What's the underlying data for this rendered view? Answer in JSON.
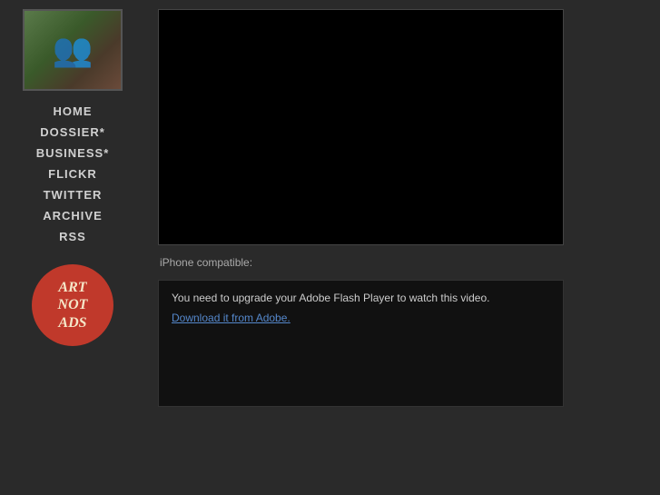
{
  "sidebar": {
    "nav_items": [
      {
        "label": "HOME",
        "id": "home"
      },
      {
        "label": "DOSSIER*",
        "id": "dossier"
      },
      {
        "label": "BUSINESS*",
        "id": "business"
      },
      {
        "label": "FLICKR",
        "id": "flickr"
      },
      {
        "label": "TWITTER",
        "id": "twitter"
      },
      {
        "label": "ARCHIVE",
        "id": "archive"
      },
      {
        "label": "RSS",
        "id": "rss"
      }
    ],
    "art_not_ads_line1": "ART",
    "art_not_ads_line2": "NOT",
    "art_not_ads_line3": "ADS"
  },
  "main": {
    "iphone_label": "iPhone compatible:",
    "flash_message": "You need to upgrade your Adobe Flash Player to watch this video.",
    "download_link_text": "Download it from Adobe."
  }
}
